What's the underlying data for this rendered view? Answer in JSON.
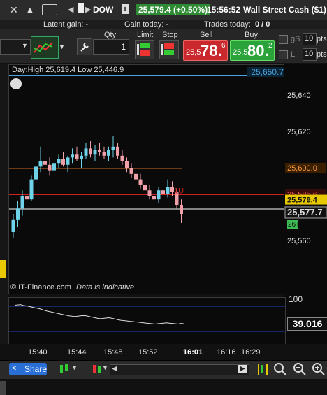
{
  "topbar": {
    "close_icon": "close-icon",
    "collapse_icon": "collapse-icon",
    "instrument_code": "DOW",
    "price_change": "25,579.4 (+0.50%)",
    "time": "15:56:52",
    "instrument_name": "Wall Street Cash ($1)"
  },
  "summary": {
    "latent_label": "Latent gain: -",
    "gain_today_label": "Gain today: -",
    "trades_today_label": "Trades today:",
    "trades_today_value": "0 / 0"
  },
  "panel": {
    "qty_label": "Qty",
    "qty_value": "1",
    "limit_label": "Limit",
    "stop_label": "Stop",
    "sell_label": "Sell",
    "buy_label": "Buy",
    "sell_prefix": "25,5",
    "sell_big": "78.",
    "sell_sup": "6",
    "buy_prefix": "25,5",
    "buy_big": "80.",
    "buy_sup": "2",
    "gs_label": "gS",
    "gs_value": "10",
    "gs_unit": "pts",
    "l_label": "L",
    "l_value": "10",
    "l_unit": "pts"
  },
  "chart_header": {
    "day_range": "Day:High 25,619.4 Low 25,446.9",
    "high_tag": "25,650.7"
  },
  "chart_data": {
    "type": "candlestick",
    "x_tick_labels": [
      "15:40",
      "15:44",
      "15:48",
      "15:52",
      "16:01",
      "16:16",
      "16:29"
    ],
    "y_tick_labels": [
      "25,640",
      "25,620",
      "25,600.0",
      "25,585.6",
      "25,579.4",
      "25,577.7",
      "25,560"
    ],
    "ylim": [
      25550,
      25650
    ],
    "levels": [
      {
        "label": "25,600.0",
        "value": 25600.0,
        "color": "#d2691e"
      },
      {
        "label": "25,585.6",
        "value": 25585.6,
        "color": "#cc2222"
      },
      {
        "label": "25,577.7",
        "value": 25577.7,
        "color": "#ffffff"
      }
    ],
    "last_price_tag": "25,579.4",
    "current_tag": "25,577.7",
    "side_tag": "26T",
    "marker_label": "1U",
    "candles": [
      {
        "o": 25565,
        "h": 25575,
        "l": 25562,
        "c": 25572
      },
      {
        "o": 25572,
        "h": 25582,
        "l": 25568,
        "c": 25578
      },
      {
        "o": 25578,
        "h": 25588,
        "l": 25574,
        "c": 25585
      },
      {
        "o": 25585,
        "h": 25590,
        "l": 25580,
        "c": 25583
      },
      {
        "o": 25583,
        "h": 25596,
        "l": 25582,
        "c": 25594
      },
      {
        "o": 25594,
        "h": 25610,
        "l": 25590,
        "c": 25601
      },
      {
        "o": 25601,
        "h": 25612,
        "l": 25598,
        "c": 25604
      },
      {
        "o": 25604,
        "h": 25609,
        "l": 25598,
        "c": 25602
      },
      {
        "o": 25602,
        "h": 25606,
        "l": 25596,
        "c": 25599
      },
      {
        "o": 25599,
        "h": 25605,
        "l": 25596,
        "c": 25603
      },
      {
        "o": 25603,
        "h": 25608,
        "l": 25600,
        "c": 25605
      },
      {
        "o": 25605,
        "h": 25609,
        "l": 25601,
        "c": 25602
      },
      {
        "o": 25602,
        "h": 25607,
        "l": 25598,
        "c": 25606
      },
      {
        "o": 25606,
        "h": 25611,
        "l": 25603,
        "c": 25608
      },
      {
        "o": 25608,
        "h": 25612,
        "l": 25604,
        "c": 25605
      },
      {
        "o": 25605,
        "h": 25609,
        "l": 25600,
        "c": 25607
      },
      {
        "o": 25607,
        "h": 25614,
        "l": 25605,
        "c": 25611
      },
      {
        "o": 25611,
        "h": 25615,
        "l": 25606,
        "c": 25608
      },
      {
        "o": 25608,
        "h": 25613,
        "l": 25604,
        "c": 25610
      },
      {
        "o": 25610,
        "h": 25614,
        "l": 25607,
        "c": 25609
      },
      {
        "o": 25609,
        "h": 25612,
        "l": 25605,
        "c": 25607
      },
      {
        "o": 25607,
        "h": 25612,
        "l": 25604,
        "c": 25610
      },
      {
        "o": 25610,
        "h": 25618,
        "l": 25606,
        "c": 25612
      },
      {
        "o": 25612,
        "h": 25614,
        "l": 25605,
        "c": 25607
      },
      {
        "o": 25607,
        "h": 25610,
        "l": 25602,
        "c": 25604
      },
      {
        "o": 25604,
        "h": 25606,
        "l": 25598,
        "c": 25600
      },
      {
        "o": 25600,
        "h": 25603,
        "l": 25595,
        "c": 25597
      },
      {
        "o": 25597,
        "h": 25600,
        "l": 25592,
        "c": 25594
      },
      {
        "o": 25594,
        "h": 25597,
        "l": 25589,
        "c": 25591
      },
      {
        "o": 25591,
        "h": 25594,
        "l": 25586,
        "c": 25588
      },
      {
        "o": 25588,
        "h": 25591,
        "l": 25583,
        "c": 25585
      },
      {
        "o": 25585,
        "h": 25588,
        "l": 25580,
        "c": 25583
      },
      {
        "o": 25583,
        "h": 25590,
        "l": 25581,
        "c": 25588
      },
      {
        "o": 25588,
        "h": 25592,
        "l": 25583,
        "c": 25586
      },
      {
        "o": 25586,
        "h": 25594,
        "l": 25584,
        "c": 25590
      },
      {
        "o": 25590,
        "h": 25593,
        "l": 25585,
        "c": 25587
      },
      {
        "o": 25587,
        "h": 25589,
        "l": 25578,
        "c": 25580
      },
      {
        "o": 25580,
        "h": 25583,
        "l": 25570,
        "c": 25575
      }
    ]
  },
  "watermark": {
    "brand": "© IT-Finance.com",
    "note": "Data is indicative"
  },
  "oscillator": {
    "top_label": "100",
    "value_tag": "39.016",
    "values": [
      90,
      91,
      92,
      89,
      88,
      86,
      84,
      82,
      80,
      78,
      75,
      72,
      70,
      68,
      66,
      64,
      62,
      60,
      58,
      56,
      55,
      54,
      55,
      56,
      57,
      56,
      54,
      52,
      50,
      48,
      47,
      48,
      49,
      50,
      48,
      46,
      44,
      42,
      41,
      40,
      39,
      38,
      37,
      36,
      35,
      34,
      33,
      32,
      31,
      30,
      31,
      32,
      33,
      34,
      33,
      32,
      31,
      30,
      32,
      31
    ]
  },
  "bottombar": {
    "share_label": "Share"
  }
}
